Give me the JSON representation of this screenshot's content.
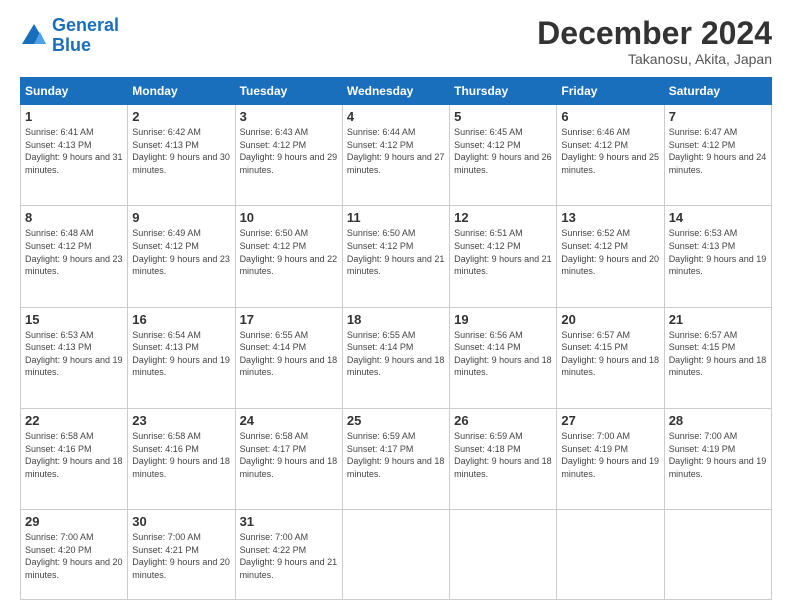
{
  "logo": {
    "line1": "General",
    "line2": "Blue"
  },
  "header": {
    "month": "December 2024",
    "location": "Takanosu, Akita, Japan"
  },
  "weekdays": [
    "Sunday",
    "Monday",
    "Tuesday",
    "Wednesday",
    "Thursday",
    "Friday",
    "Saturday"
  ],
  "weeks": [
    [
      {
        "day": "1",
        "sunrise": "Sunrise: 6:41 AM",
        "sunset": "Sunset: 4:13 PM",
        "daylight": "Daylight: 9 hours and 31 minutes."
      },
      {
        "day": "2",
        "sunrise": "Sunrise: 6:42 AM",
        "sunset": "Sunset: 4:13 PM",
        "daylight": "Daylight: 9 hours and 30 minutes."
      },
      {
        "day": "3",
        "sunrise": "Sunrise: 6:43 AM",
        "sunset": "Sunset: 4:12 PM",
        "daylight": "Daylight: 9 hours and 29 minutes."
      },
      {
        "day": "4",
        "sunrise": "Sunrise: 6:44 AM",
        "sunset": "Sunset: 4:12 PM",
        "daylight": "Daylight: 9 hours and 27 minutes."
      },
      {
        "day": "5",
        "sunrise": "Sunrise: 6:45 AM",
        "sunset": "Sunset: 4:12 PM",
        "daylight": "Daylight: 9 hours and 26 minutes."
      },
      {
        "day": "6",
        "sunrise": "Sunrise: 6:46 AM",
        "sunset": "Sunset: 4:12 PM",
        "daylight": "Daylight: 9 hours and 25 minutes."
      },
      {
        "day": "7",
        "sunrise": "Sunrise: 6:47 AM",
        "sunset": "Sunset: 4:12 PM",
        "daylight": "Daylight: 9 hours and 24 minutes."
      }
    ],
    [
      {
        "day": "8",
        "sunrise": "Sunrise: 6:48 AM",
        "sunset": "Sunset: 4:12 PM",
        "daylight": "Daylight: 9 hours and 23 minutes."
      },
      {
        "day": "9",
        "sunrise": "Sunrise: 6:49 AM",
        "sunset": "Sunset: 4:12 PM",
        "daylight": "Daylight: 9 hours and 23 minutes."
      },
      {
        "day": "10",
        "sunrise": "Sunrise: 6:50 AM",
        "sunset": "Sunset: 4:12 PM",
        "daylight": "Daylight: 9 hours and 22 minutes."
      },
      {
        "day": "11",
        "sunrise": "Sunrise: 6:50 AM",
        "sunset": "Sunset: 4:12 PM",
        "daylight": "Daylight: 9 hours and 21 minutes."
      },
      {
        "day": "12",
        "sunrise": "Sunrise: 6:51 AM",
        "sunset": "Sunset: 4:12 PM",
        "daylight": "Daylight: 9 hours and 21 minutes."
      },
      {
        "day": "13",
        "sunrise": "Sunrise: 6:52 AM",
        "sunset": "Sunset: 4:12 PM",
        "daylight": "Daylight: 9 hours and 20 minutes."
      },
      {
        "day": "14",
        "sunrise": "Sunrise: 6:53 AM",
        "sunset": "Sunset: 4:13 PM",
        "daylight": "Daylight: 9 hours and 19 minutes."
      }
    ],
    [
      {
        "day": "15",
        "sunrise": "Sunrise: 6:53 AM",
        "sunset": "Sunset: 4:13 PM",
        "daylight": "Daylight: 9 hours and 19 minutes."
      },
      {
        "day": "16",
        "sunrise": "Sunrise: 6:54 AM",
        "sunset": "Sunset: 4:13 PM",
        "daylight": "Daylight: 9 hours and 19 minutes."
      },
      {
        "day": "17",
        "sunrise": "Sunrise: 6:55 AM",
        "sunset": "Sunset: 4:14 PM",
        "daylight": "Daylight: 9 hours and 18 minutes."
      },
      {
        "day": "18",
        "sunrise": "Sunrise: 6:55 AM",
        "sunset": "Sunset: 4:14 PM",
        "daylight": "Daylight: 9 hours and 18 minutes."
      },
      {
        "day": "19",
        "sunrise": "Sunrise: 6:56 AM",
        "sunset": "Sunset: 4:14 PM",
        "daylight": "Daylight: 9 hours and 18 minutes."
      },
      {
        "day": "20",
        "sunrise": "Sunrise: 6:57 AM",
        "sunset": "Sunset: 4:15 PM",
        "daylight": "Daylight: 9 hours and 18 minutes."
      },
      {
        "day": "21",
        "sunrise": "Sunrise: 6:57 AM",
        "sunset": "Sunset: 4:15 PM",
        "daylight": "Daylight: 9 hours and 18 minutes."
      }
    ],
    [
      {
        "day": "22",
        "sunrise": "Sunrise: 6:58 AM",
        "sunset": "Sunset: 4:16 PM",
        "daylight": "Daylight: 9 hours and 18 minutes."
      },
      {
        "day": "23",
        "sunrise": "Sunrise: 6:58 AM",
        "sunset": "Sunset: 4:16 PM",
        "daylight": "Daylight: 9 hours and 18 minutes."
      },
      {
        "day": "24",
        "sunrise": "Sunrise: 6:58 AM",
        "sunset": "Sunset: 4:17 PM",
        "daylight": "Daylight: 9 hours and 18 minutes."
      },
      {
        "day": "25",
        "sunrise": "Sunrise: 6:59 AM",
        "sunset": "Sunset: 4:17 PM",
        "daylight": "Daylight: 9 hours and 18 minutes."
      },
      {
        "day": "26",
        "sunrise": "Sunrise: 6:59 AM",
        "sunset": "Sunset: 4:18 PM",
        "daylight": "Daylight: 9 hours and 18 minutes."
      },
      {
        "day": "27",
        "sunrise": "Sunrise: 7:00 AM",
        "sunset": "Sunset: 4:19 PM",
        "daylight": "Daylight: 9 hours and 19 minutes."
      },
      {
        "day": "28",
        "sunrise": "Sunrise: 7:00 AM",
        "sunset": "Sunset: 4:19 PM",
        "daylight": "Daylight: 9 hours and 19 minutes."
      }
    ],
    [
      {
        "day": "29",
        "sunrise": "Sunrise: 7:00 AM",
        "sunset": "Sunset: 4:20 PM",
        "daylight": "Daylight: 9 hours and 20 minutes."
      },
      {
        "day": "30",
        "sunrise": "Sunrise: 7:00 AM",
        "sunset": "Sunset: 4:21 PM",
        "daylight": "Daylight: 9 hours and 20 minutes."
      },
      {
        "day": "31",
        "sunrise": "Sunrise: 7:00 AM",
        "sunset": "Sunset: 4:22 PM",
        "daylight": "Daylight: 9 hours and 21 minutes."
      },
      null,
      null,
      null,
      null
    ]
  ]
}
